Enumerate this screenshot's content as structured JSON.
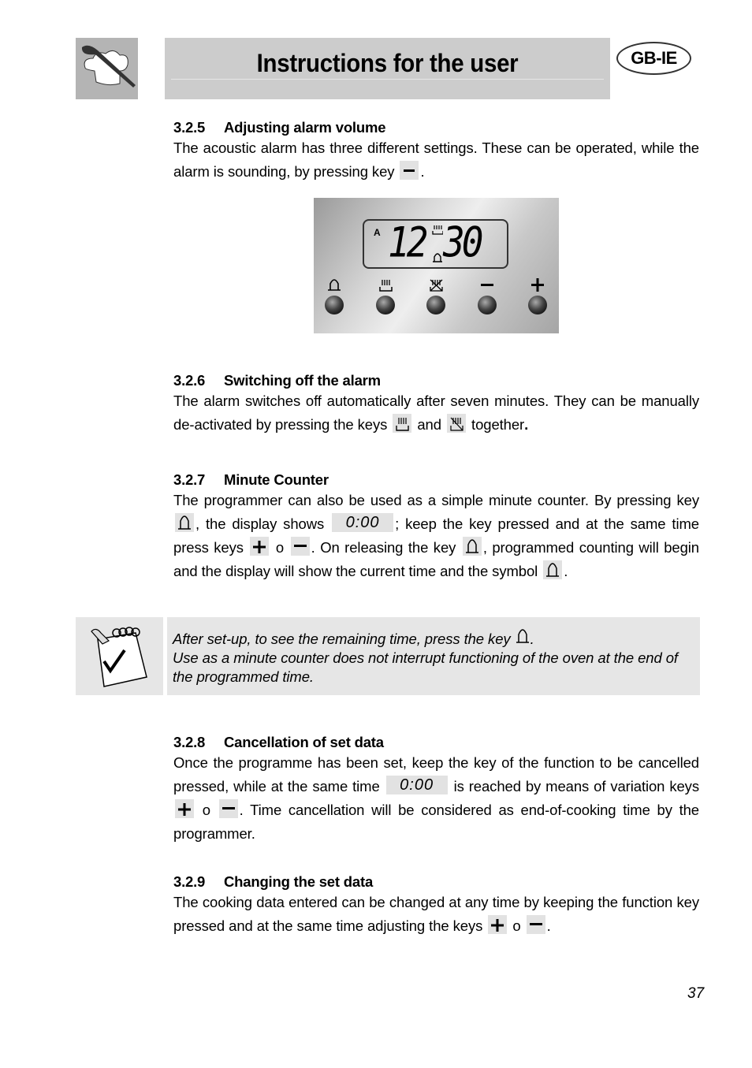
{
  "header": {
    "title": "Instructions for the user",
    "country_badge": "GB-IE",
    "logo_icon": "chef-hat-spoon-icon"
  },
  "sections": [
    {
      "number": "3.2.5",
      "heading": "Adjusting alarm volume",
      "text_1": "The acoustic alarm has three different settings. These can be operated, while the alarm is sounding, by pressing key",
      "key_1": "minus-key-icon",
      "text_end": "."
    },
    {
      "number": "3.2.6",
      "heading": "Switching off the alarm",
      "text_1": "The alarm switches off automatically after seven minutes. They can be manually de-activated by pressing the keys",
      "key_1": "cooking-duration-key-icon",
      "text_2": "and",
      "key_2": "end-of-cooking-key-icon",
      "text_3": "together",
      "text_end": "."
    },
    {
      "number": "3.2.7",
      "heading": "Minute Counter",
      "text_1": "The programmer can also be used as a simple minute counter. By pressing key",
      "text_2": ", the display shows",
      "display_value": "0:00",
      "text_3": "; keep the key pressed and at the same time press keys",
      "text_4": "o",
      "text_5": ". On releasing the key",
      "text_6": ", programmed counting will begin and the display will show the current time and the symbol",
      "text_end": "."
    },
    {
      "number": "3.2.8",
      "heading": "Cancellation of set data",
      "text_1": "Once the programme has been set, keep the key of the function to be cancelled pressed, while at the same time",
      "display_value": "0:00",
      "text_2": "is reached by means of variation keys",
      "text_3": "o",
      "text_4": ". Time cancellation will be considered as end-of-cooking time by the programmer."
    },
    {
      "number": "3.2.9",
      "heading": "Changing the set data",
      "text_1": "The cooking data entered can be changed at any time by keeping the function key pressed and at the same time adjusting the keys",
      "text_2": "o",
      "text_end": "."
    }
  ],
  "note": {
    "icon": "notepad-check-icon",
    "line_1": "After set-up, to see the remaining time, press the key",
    "line_1_end": ".",
    "line_2": "Use as a minute counter does not interrupt functioning of the oven at the end of the programmed time."
  },
  "panel": {
    "indicator": "A",
    "hours": "12",
    "minutes": "30",
    "buttons": [
      "bell",
      "cooking-duration",
      "end-of-cooking",
      "minus",
      "plus"
    ]
  },
  "page_number": "37"
}
